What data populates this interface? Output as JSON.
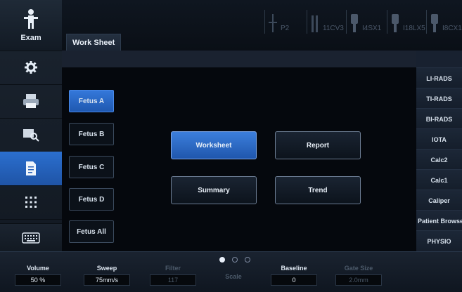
{
  "left_sidebar": {
    "exam_label": "Exam"
  },
  "header": {
    "tab_label": "Work Sheet"
  },
  "probes": [
    "P2",
    "11CV3",
    "I4SX1",
    "I18LX5",
    "I8CX1"
  ],
  "fetus_buttons": [
    "Fetus A",
    "Fetus B",
    "Fetus C",
    "Fetus D",
    "Fetus All"
  ],
  "main_buttons": {
    "worksheet": "Worksheet",
    "report": "Report",
    "summary": "Summary",
    "trend": "Trend"
  },
  "right_sidebar": [
    "LI-RADS",
    "TI-RADS",
    "BI-RADS",
    "IOTA",
    "Calc2",
    "Calc1",
    "Caliper",
    "Patient Browser",
    "PHYSIO"
  ],
  "bottom_controls": {
    "volume": {
      "label": "Volume",
      "value": "50 %"
    },
    "sweep": {
      "label": "Sweep",
      "value": "75mm/s"
    },
    "filter": {
      "label": "Filter",
      "value": "117"
    },
    "scale": {
      "label": "Scale"
    },
    "baseline": {
      "label": "Baseline",
      "value": "0"
    },
    "gate_size": {
      "label": "Gate Size",
      "value": "2.0mm"
    }
  },
  "colors": {
    "accent": "#2a6fd0",
    "panel": "#1b2430"
  }
}
